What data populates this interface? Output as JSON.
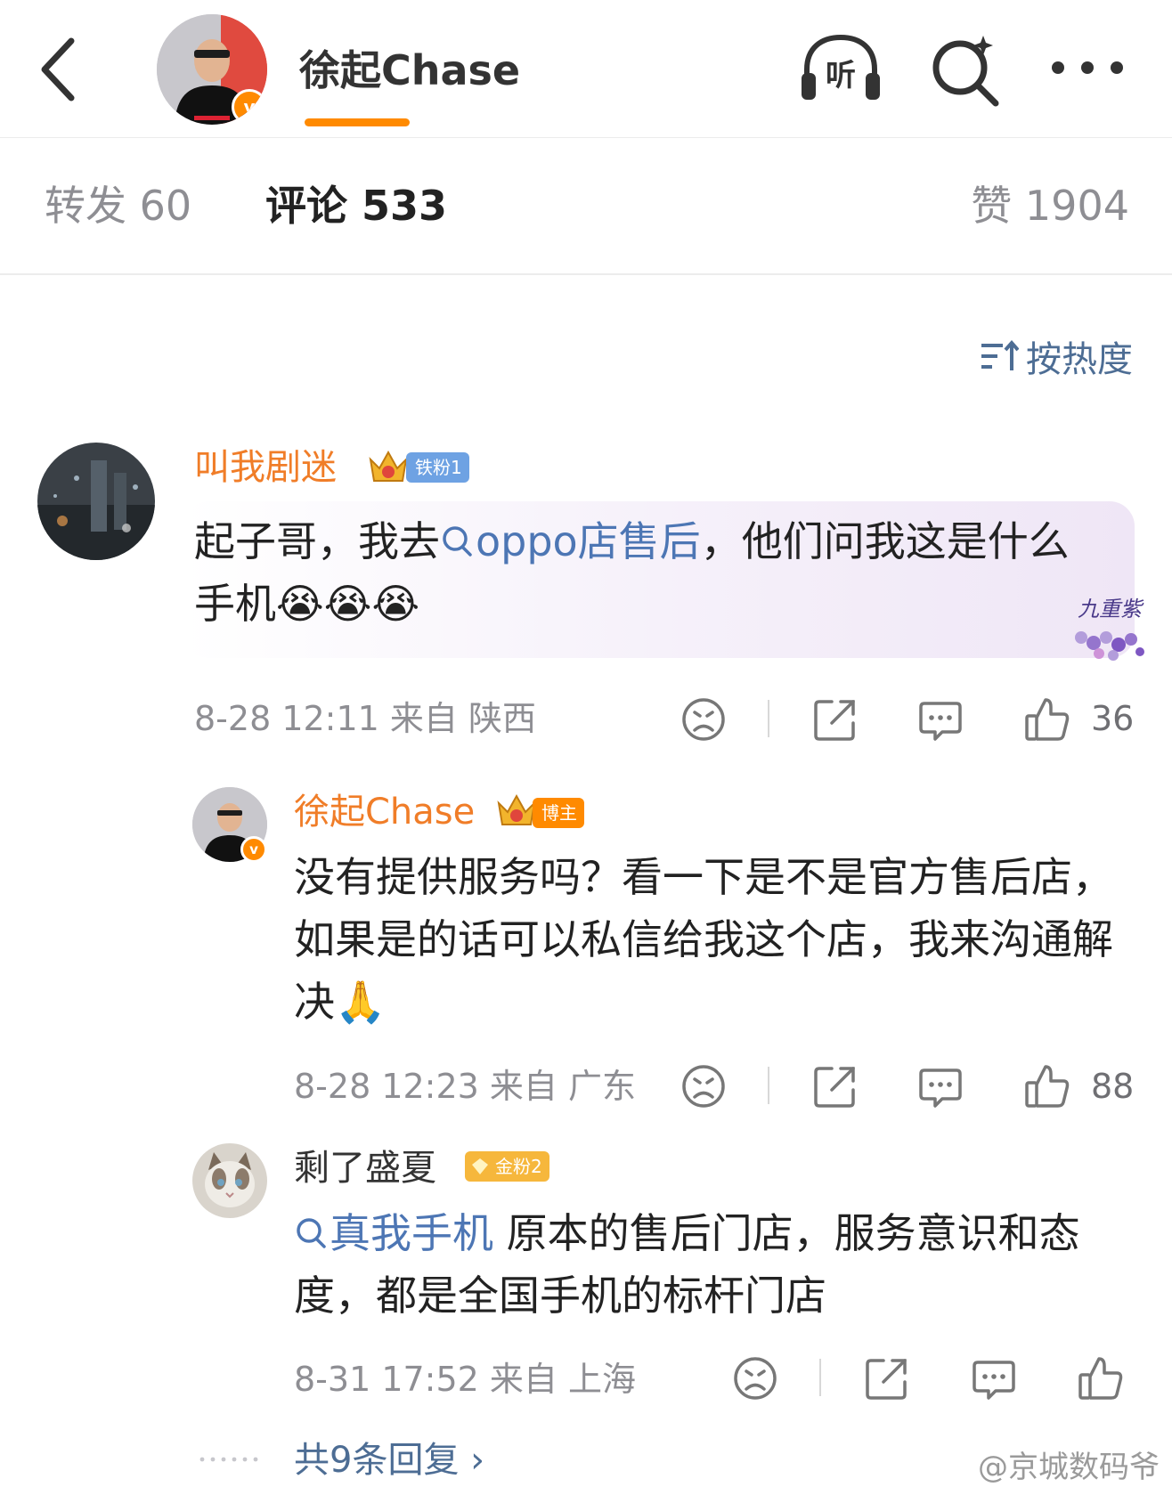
{
  "header": {
    "title": "徐起Chase",
    "back_icon": "chevron-left-icon",
    "listen_label": "听",
    "verified_mark": "v"
  },
  "tabs": [
    {
      "label": "转发 60"
    },
    {
      "label": "评论 533",
      "active": true
    },
    {
      "label": "赞 1904"
    }
  ],
  "sort": {
    "label": "按热度"
  },
  "comments": [
    {
      "user": "叫我剧迷",
      "level_badge": "铁粉1",
      "text_before": "起子哥，我去",
      "link": "oppo店售后",
      "text_after": "，他们问我这是什么手机😭😭😭",
      "time_location": "8-28 12:11  来自 陕西",
      "likes": "36",
      "bubble_decoration_text": "九重紫"
    },
    {
      "user": "徐起Chase",
      "level_badge": "博主",
      "text": "没有提供服务吗？看一下是不是官方售后店，如果是的话可以私信给我这个店，我来沟通解决🙏",
      "time_location": "8-28 12:23  来自 广东",
      "likes": "88"
    },
    {
      "user": "剩了盛夏",
      "level_badge": "金粉2",
      "link": "真我手机",
      "text_after": " 原本的售后门店，服务意识和态度，都是全国手机的标杆门店",
      "time_location": "8-31 17:52  来自 上海",
      "likes": ""
    }
  ],
  "more_replies": "共9条回复 ›",
  "watermark": "@京城数码爷",
  "colors": {
    "accent": "#ff8a00",
    "link": "#4d76b4",
    "username_highlight": "#f07d28",
    "muted": "#8e8e93"
  }
}
